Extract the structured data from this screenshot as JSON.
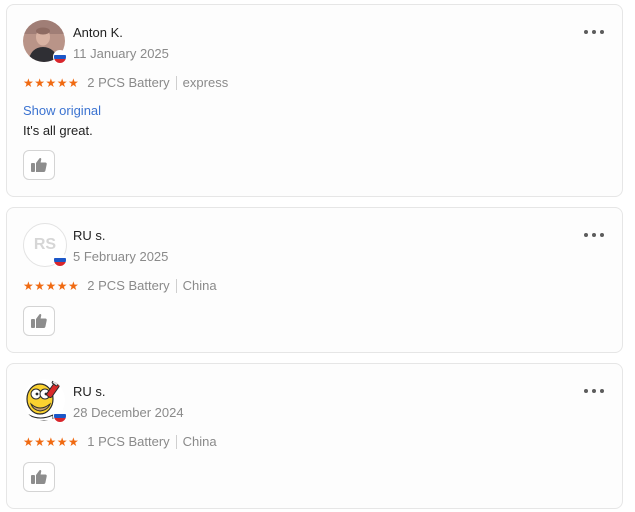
{
  "reviews": [
    {
      "author": "Anton K.",
      "date": "11 January 2025",
      "stars": "★★★★★",
      "product": "2 PCS Battery",
      "shipping": "express",
      "show_original": "Show original",
      "text": "It's all great.",
      "avatar_type": "photo"
    },
    {
      "author": "RU s.",
      "date": "5 February 2025",
      "stars": "★★★★★",
      "product": "2 PCS Battery",
      "shipping": "China",
      "avatar_initials": "RS",
      "avatar_type": "initials"
    },
    {
      "author": "RU s.",
      "date": "28 December 2024",
      "stars": "★★★★★",
      "product": "1 PCS Battery",
      "shipping": "China",
      "avatar_type": "cartoon"
    }
  ],
  "colors": {
    "star": "#f06a12",
    "link": "#3b73d1",
    "card_border": "#e6e6e6",
    "muted_text": "#8a8a8a"
  },
  "icons": {
    "more": "more-dots-icon",
    "like": "thumbs-up-icon",
    "flag": "russia-flag-icon"
  }
}
